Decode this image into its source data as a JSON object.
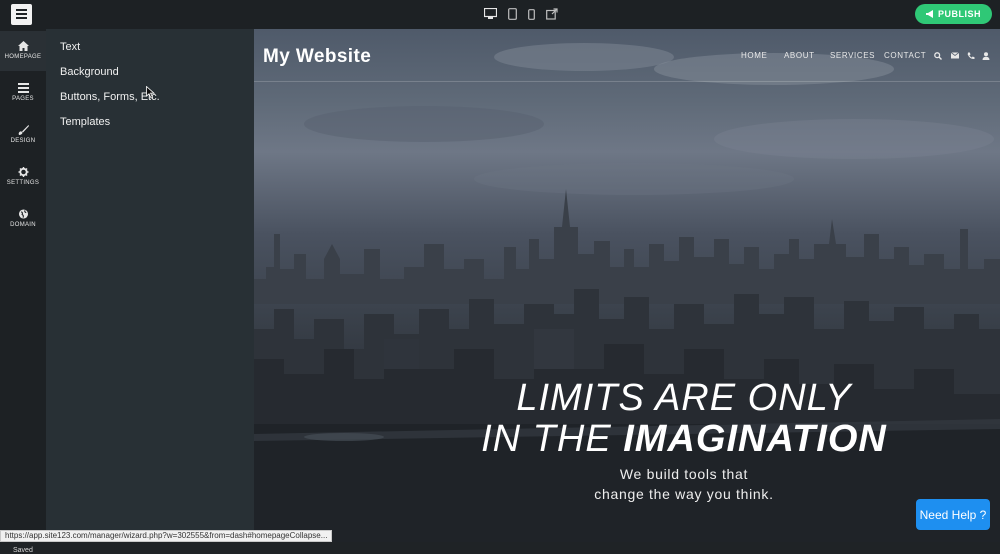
{
  "topbar": {
    "logo_icon": "hamburger-logo-icon",
    "device_icons": [
      "desktop-icon",
      "tablet-icon",
      "mobile-icon",
      "external-link-icon"
    ],
    "publish_label": "PUBLISH",
    "publish_icon": "megaphone-icon",
    "publish_color": "#2fc876"
  },
  "rail": {
    "items": [
      {
        "label": "HOMEPAGE",
        "icon": "home-icon",
        "active": true
      },
      {
        "label": "PAGES",
        "icon": "pages-icon",
        "active": false
      },
      {
        "label": "DESIGN",
        "icon": "brush-icon",
        "active": false
      },
      {
        "label": "SETTINGS",
        "icon": "gear-icon",
        "active": false
      },
      {
        "label": "DOMAIN",
        "icon": "globe-icon",
        "active": false
      }
    ],
    "status": "Saved"
  },
  "panel": {
    "items": [
      "Text",
      "Background",
      "Buttons, Forms, Etc.",
      "Templates"
    ]
  },
  "preview": {
    "site_title": "My Website",
    "nav": [
      "HOME",
      "ABOUT",
      "SERVICES",
      "CONTACT"
    ],
    "nav_icons": [
      "search-icon",
      "mail-icon",
      "phone-icon",
      "user-icon"
    ],
    "headline_line1": "LIMITS ARE ONLY",
    "headline_line2_a": "IN THE ",
    "headline_line2_b": "IMAGINATION",
    "subline_1": "We build tools that",
    "subline_2": "change the way you think."
  },
  "help_button": {
    "label": "Need Help ?",
    "color": "#1e8ff0"
  },
  "status_url": "https://app.site123.com/manager/wizard.php?w=302555&from=dash#homepageCollapse..."
}
